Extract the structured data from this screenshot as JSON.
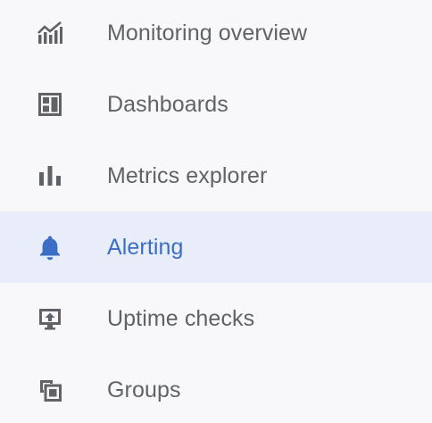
{
  "nav": {
    "items": [
      {
        "label": "Monitoring overview",
        "icon": "monitoring-chart-icon",
        "active": false
      },
      {
        "label": "Dashboards",
        "icon": "dashboard-grid-icon",
        "active": false
      },
      {
        "label": "Metrics explorer",
        "icon": "bar-chart-icon",
        "active": false
      },
      {
        "label": "Alerting",
        "icon": "bell-icon",
        "active": true
      },
      {
        "label": "Uptime checks",
        "icon": "monitor-upload-icon",
        "active": false
      },
      {
        "label": "Groups",
        "icon": "overlapping-squares-icon",
        "active": false
      }
    ]
  },
  "colors": {
    "background": "#f8f8fa",
    "text": "#5f6368",
    "icon": "#5f6368",
    "active_text": "#3b6ec4",
    "active_icon": "#3b6ec4",
    "active_background": "#e8edf9"
  }
}
